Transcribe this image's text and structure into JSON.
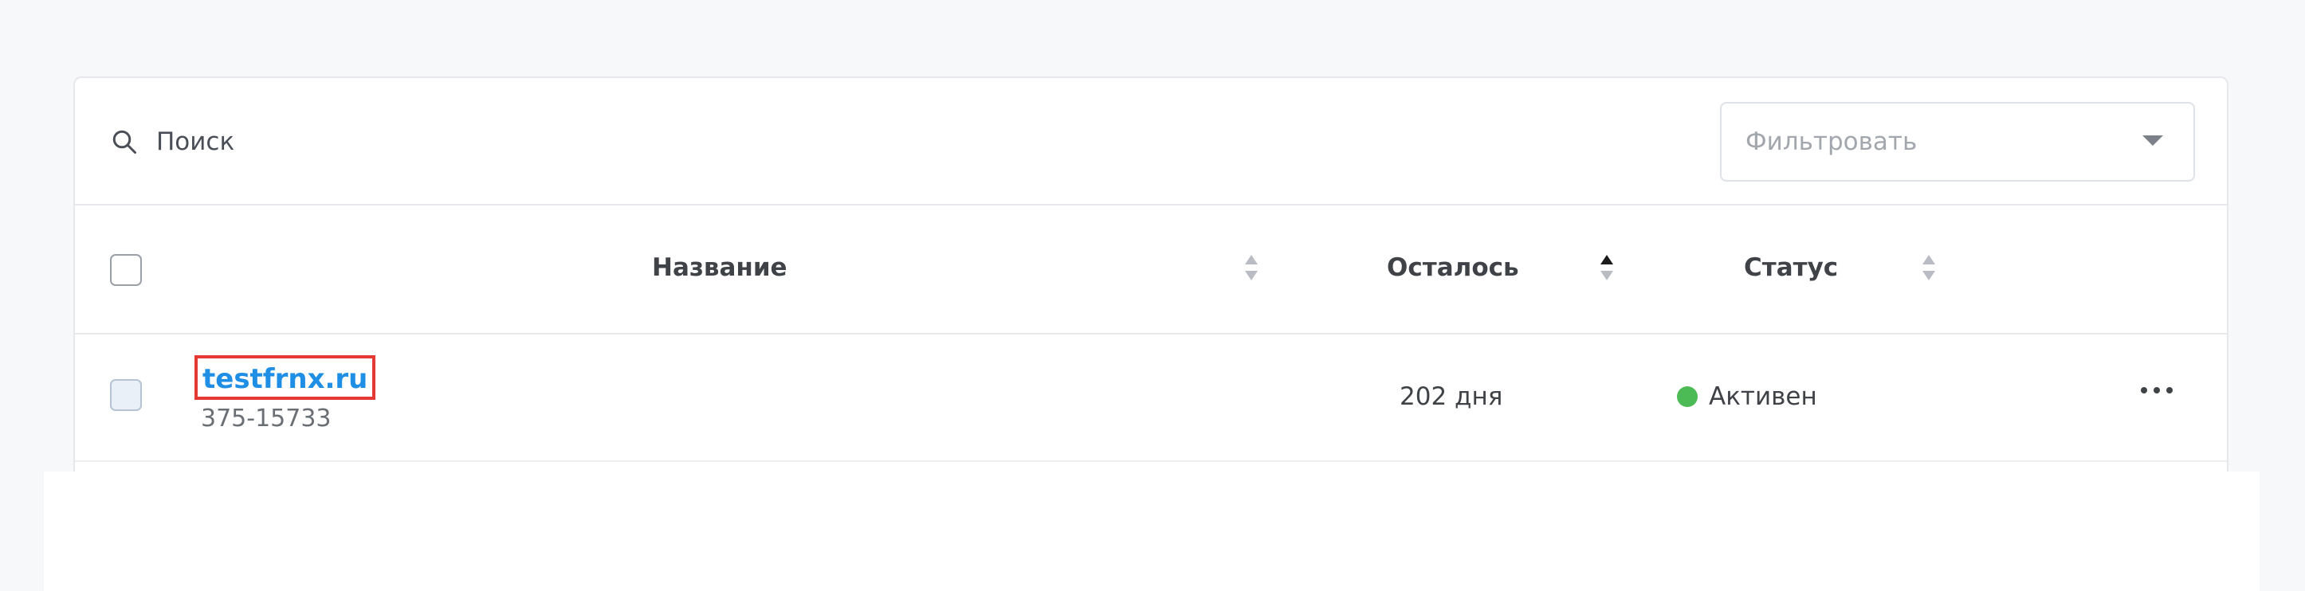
{
  "search": {
    "placeholder": "Поиск"
  },
  "filter": {
    "placeholder": "Фильтровать"
  },
  "table": {
    "columns": [
      {
        "label": "Название"
      },
      {
        "label": "Осталось"
      },
      {
        "label": "Статус"
      }
    ],
    "rows": [
      {
        "domain": "testfrnx.ru",
        "id": "375-15733",
        "remaining": "202 дня",
        "status": "Активен",
        "status_color": "#4cbb55"
      }
    ]
  },
  "colors": {
    "link": "#1f8fe6",
    "highlight_border": "#e53935",
    "status_active": "#4cbb55"
  },
  "icons": {
    "search": "search-icon",
    "filter_caret": "chevron-down-icon",
    "sort": "sort-icon",
    "more": "more-horizontal-icon"
  }
}
